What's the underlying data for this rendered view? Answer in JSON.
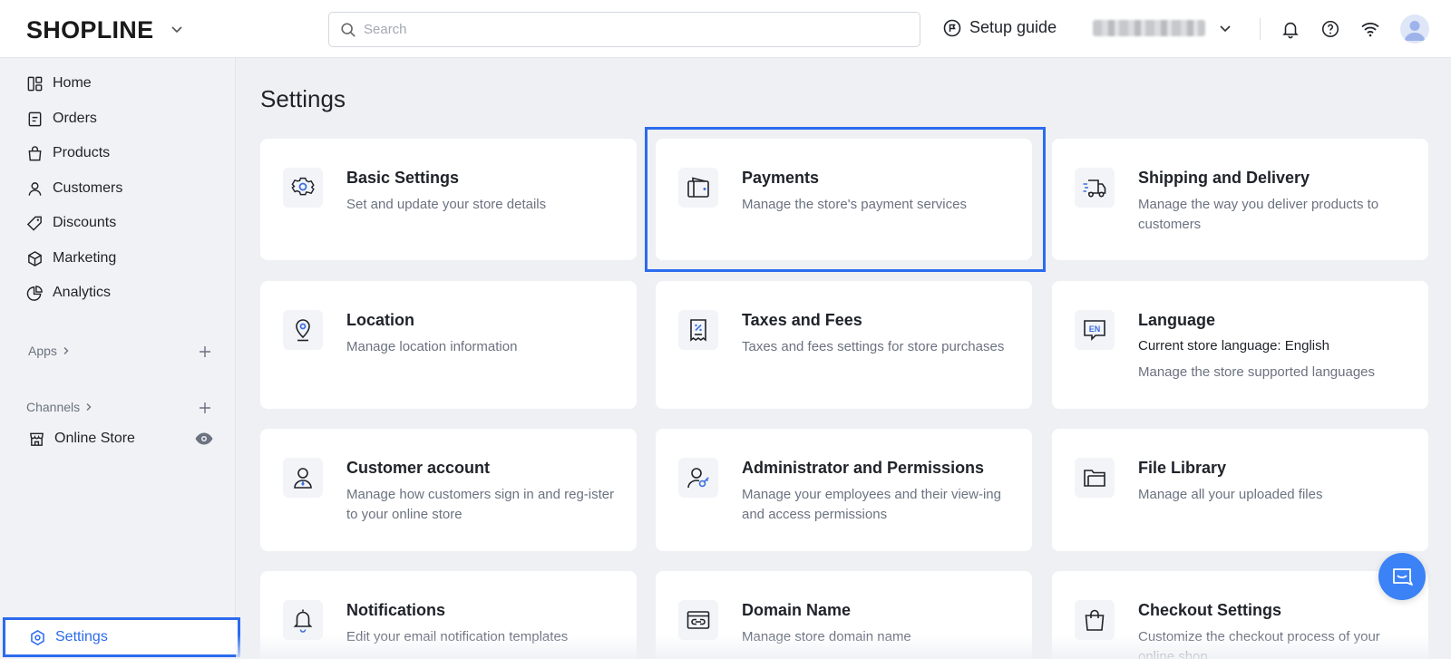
{
  "header": {
    "logo_text": "SHOPLINE",
    "search": {
      "placeholder": "Search",
      "value": ""
    },
    "setup_guide_label": "Setup guide"
  },
  "sidebar": {
    "items": [
      {
        "label": "Home",
        "icon": "home-icon"
      },
      {
        "label": "Orders",
        "icon": "orders-icon"
      },
      {
        "label": "Products",
        "icon": "products-icon"
      },
      {
        "label": "Customers",
        "icon": "customers-icon"
      },
      {
        "label": "Discounts",
        "icon": "discounts-icon"
      },
      {
        "label": "Marketing",
        "icon": "marketing-icon"
      },
      {
        "label": "Analytics",
        "icon": "analytics-icon"
      }
    ],
    "apps_label": "Apps",
    "channels_label": "Channels",
    "online_store_label": "Online Store",
    "settings_label": "Settings"
  },
  "main": {
    "title": "Settings",
    "cards": [
      {
        "title": "Basic Settings",
        "desc": "Set and update your store details",
        "icon": "gear-icon"
      },
      {
        "title": "Payments",
        "desc": "Manage the store's payment services",
        "icon": "wallet-icon"
      },
      {
        "title": "Shipping and Delivery",
        "desc": "Manage the way you deliver products to customers",
        "icon": "truck-icon"
      },
      {
        "title": "Location",
        "desc": "Manage location information",
        "icon": "location-pin-icon"
      },
      {
        "title": "Taxes and Fees",
        "desc": "Taxes and fees settings for store purchases",
        "icon": "receipt-icon"
      },
      {
        "title": "Language",
        "current": "Current store language: English",
        "desc": "Manage the store supported languages",
        "icon": "language-icon"
      },
      {
        "title": "Customer account",
        "desc": "Manage how customers sign in and reg-ister to your online store",
        "icon": "user-icon"
      },
      {
        "title": "Administrator and Permissions",
        "desc": "Manage your employees and their view-ing and access permissions",
        "icon": "admin-key-icon"
      },
      {
        "title": "File Library",
        "desc": "Manage all your uploaded files",
        "icon": "folder-icon"
      },
      {
        "title": "Notifications",
        "desc": "Edit your email notification templates",
        "icon": "bell-icon"
      },
      {
        "title": "Domain Name",
        "desc": "Manage store domain name",
        "icon": "domain-link-icon"
      },
      {
        "title": "Checkout Settings",
        "desc": "Customize the checkout process of your online shop",
        "icon": "shopping-bag-icon"
      }
    ]
  },
  "colors": {
    "accent": "#2c6bed",
    "icon_blue": "#3b6fe0"
  }
}
